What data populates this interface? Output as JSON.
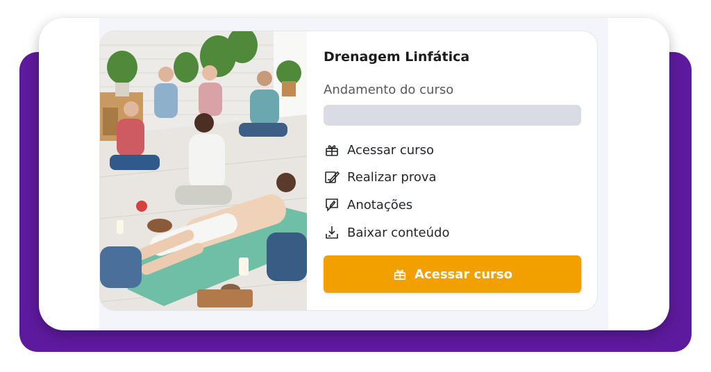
{
  "course": {
    "title": "Drenagem Linfática",
    "progress_label": "Andamento do curso",
    "progress_value": 0,
    "image_alt": "course-thumbnail"
  },
  "actions": [
    {
      "label": "Acessar curso",
      "icon": "gift-box-icon"
    },
    {
      "label": "Realizar prova",
      "icon": "exam-pencil-icon"
    },
    {
      "label": "Anotações",
      "icon": "note-pencil-icon"
    },
    {
      "label": "Baixar conteúdo",
      "icon": "download-tray-icon"
    }
  ],
  "cta": {
    "label": "Acessar curso",
    "icon": "gift-box-icon"
  },
  "colors": {
    "frame_purple": "#5e1a9e",
    "accent_orange": "#f2a000",
    "progress_track": "#d9dde3"
  }
}
